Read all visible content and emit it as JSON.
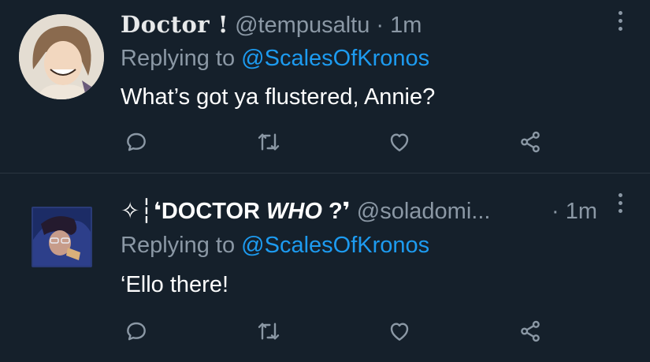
{
  "tweets": [
    {
      "name": "Doctor !",
      "handle": "@tempusaltu",
      "separator": "·",
      "time": "1m",
      "replying_prefix": "Replying to",
      "replying_to": "@ScalesOfKronos",
      "text": "What’s got ya flustered, Annie?"
    },
    {
      "name_prefix": "✧┆❛",
      "name_bold": "DOCTOR ",
      "name_italic": "WHO",
      "name_suffix": " ?❜",
      "handle": "@soladomi...",
      "separator": "·",
      "time": "1m",
      "replying_prefix": "Replying to",
      "replying_to": "@ScalesOfKronos",
      "text": "‘Ello there!"
    }
  ],
  "colors": {
    "background": "#15202b",
    "secondary_text": "#8b98a5",
    "link": "#1d9bf0",
    "divider": "#2b3640"
  },
  "icons": [
    "reply-icon",
    "retweet-icon",
    "like-icon",
    "share-icon",
    "more-icon"
  ]
}
